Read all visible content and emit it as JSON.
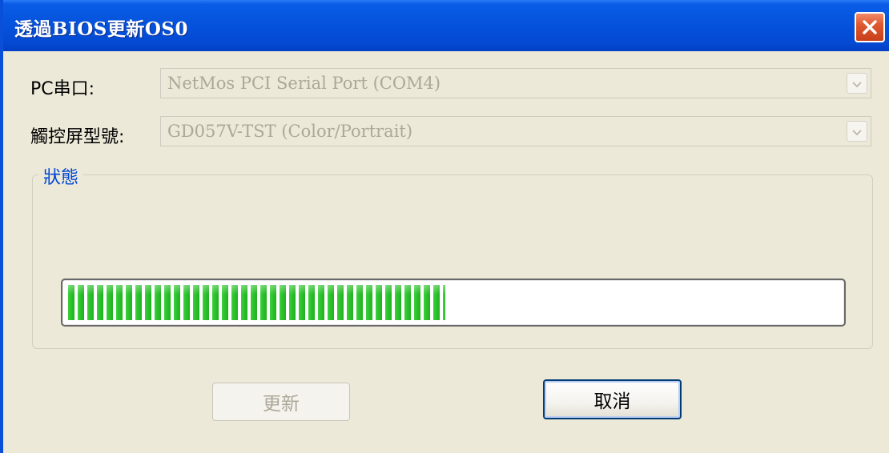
{
  "window": {
    "title": "透過BIOS更新OS0"
  },
  "form": {
    "pc_port_label": "PC串口:",
    "pc_port_value": "NetMos PCI Serial Port (COM4)",
    "model_label": "觸控屏型號:",
    "model_value": "GD057V-TST (Color/Portrait)"
  },
  "status": {
    "group_label": "狀態",
    "progress_fraction": 0.49
  },
  "buttons": {
    "update_label": "更新",
    "cancel_label": "取消"
  },
  "icons": {
    "close": "close-icon",
    "dropdown": "chevron-down-icon"
  },
  "colors": {
    "titlebar": "#0552dc",
    "window_bg": "#ece9d8",
    "progress_green": "#2ec42e",
    "group_label": "#0046d5",
    "close_button": "#e0582e"
  }
}
